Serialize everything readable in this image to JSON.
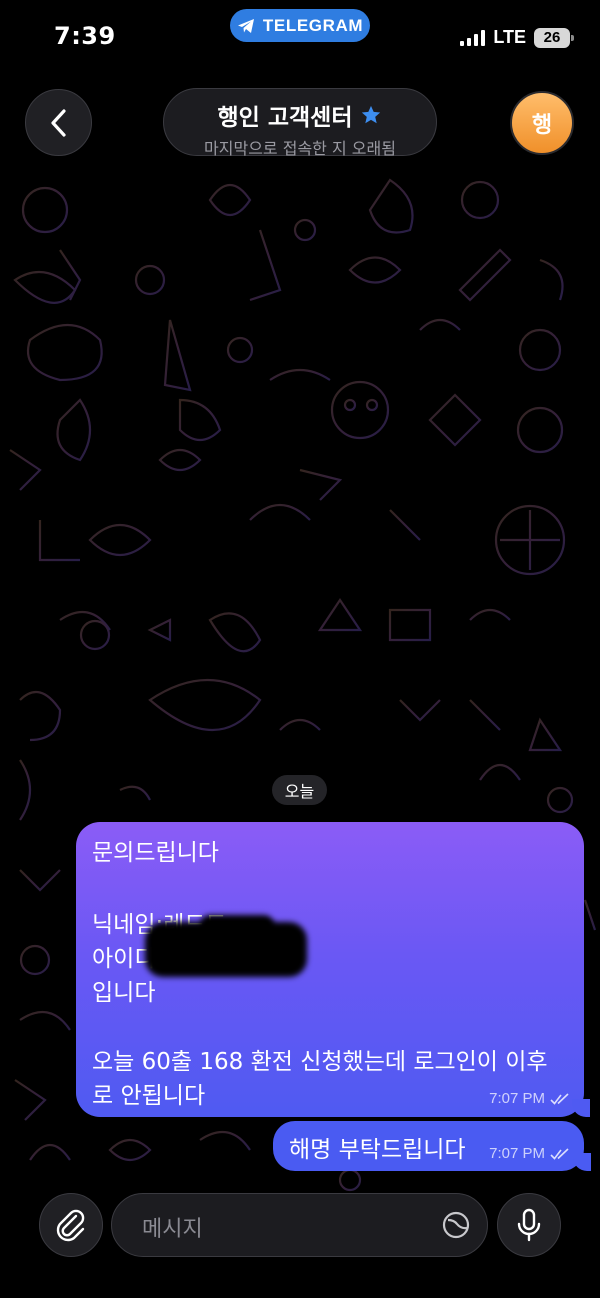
{
  "status_bar": {
    "time": "7:39",
    "app_pill": "TELEGRAM",
    "network": "LTE",
    "battery": "26"
  },
  "header": {
    "title": "행인 고객센터",
    "subtitle": "마지막으로 접속한 지 오래됨",
    "avatar_letter": "행",
    "back_icon": "chevron-left-icon",
    "verified_icon": "star-icon"
  },
  "chat": {
    "date_label": "오늘",
    "messages": [
      {
        "lines": [
          "문의드립니다",
          "",
          "닉네임:레드드",
          "아이디",
          "입니다",
          "",
          "오늘 60출 168 환전 신청했는데 로그인이 이후",
          "로 안됩니다"
        ],
        "time": "7:07 PM",
        "status": "read"
      },
      {
        "lines": [
          "해명 부탁드립니다"
        ],
        "time": "7:07 PM",
        "status": "read"
      }
    ]
  },
  "composer": {
    "placeholder": "메시지",
    "attach_icon": "paperclip-icon",
    "sticker_icon": "sticker-icon",
    "mic_icon": "microphone-icon"
  },
  "colors": {
    "outgoing_bubble_top": "#8b5cf6",
    "outgoing_bubble_bottom": "#4f5af2",
    "telegram_blue": "#2f7de1",
    "avatar_orange": "#f0902a"
  }
}
